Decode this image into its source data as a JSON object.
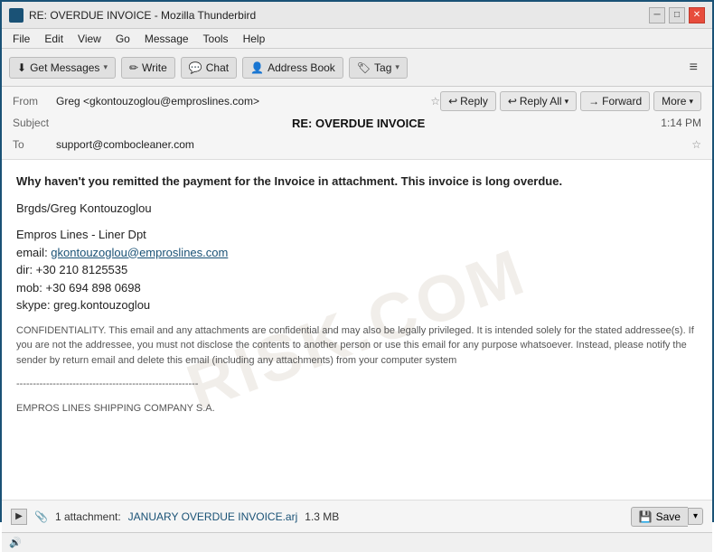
{
  "window": {
    "title": "RE: OVERDUE INVOICE - Mozilla Thunderbird"
  },
  "title_controls": {
    "minimize": "─",
    "maximize": "□",
    "close": "✕"
  },
  "menu": {
    "items": [
      "File",
      "Edit",
      "View",
      "Go",
      "Message",
      "Tools",
      "Help"
    ]
  },
  "toolbar": {
    "get_messages_label": "Get Messages",
    "write_label": "Write",
    "chat_label": "Chat",
    "address_book_label": "Address Book",
    "tag_label": "Tag",
    "menu_icon": "≡"
  },
  "email_header": {
    "from_label": "From",
    "from_value": "Greg <gkontouzoglou@emproslines.com>",
    "subject_label": "Subject",
    "subject_value": "RE: OVERDUE INVOICE",
    "to_label": "To",
    "to_value": "support@combocleaner.com",
    "time": "1:14 PM",
    "reply_label": "Reply",
    "reply_all_label": "Reply All",
    "forward_label": "Forward",
    "more_label": "More"
  },
  "email_body": {
    "opening": "Why haven't you remitted the payment for the Invoice in attachment. This  invoice is long overdue.",
    "greeting": "Brgds/Greg Kontouzoglou",
    "company": "Empros Lines - Liner Dpt",
    "email_label": "email:",
    "email_link": "gkontouzoglou@emproslines.com",
    "dir_label": "dir: +30 210 8125535",
    "mob_label": "mob: +30 694 898 0698",
    "skype_label": "skype: greg.kontouzoglou",
    "confidentiality": "CONFIDENTIALITY. This email and any attachments are confidential and may also be legally privileged. It is intended solely for the stated addressee(s). If you are not the addressee, you must not disclose the contents to another person or use this email for any purpose whatsoever. Instead, please notify the sender by return email and delete this email (including any attachments) from your computer system",
    "separator": "-------------------------------------------------------",
    "company_full": "EMPROS LINES SHIPPING COMPANY S.A.",
    "watermark": "RISK.COM"
  },
  "attachment": {
    "count": "1 attachment:",
    "filename": "JANUARY OVERDUE INVOICE.arj",
    "size": "1.3 MB",
    "save_label": "Save"
  },
  "status_bar": {
    "icon": "🔊"
  }
}
